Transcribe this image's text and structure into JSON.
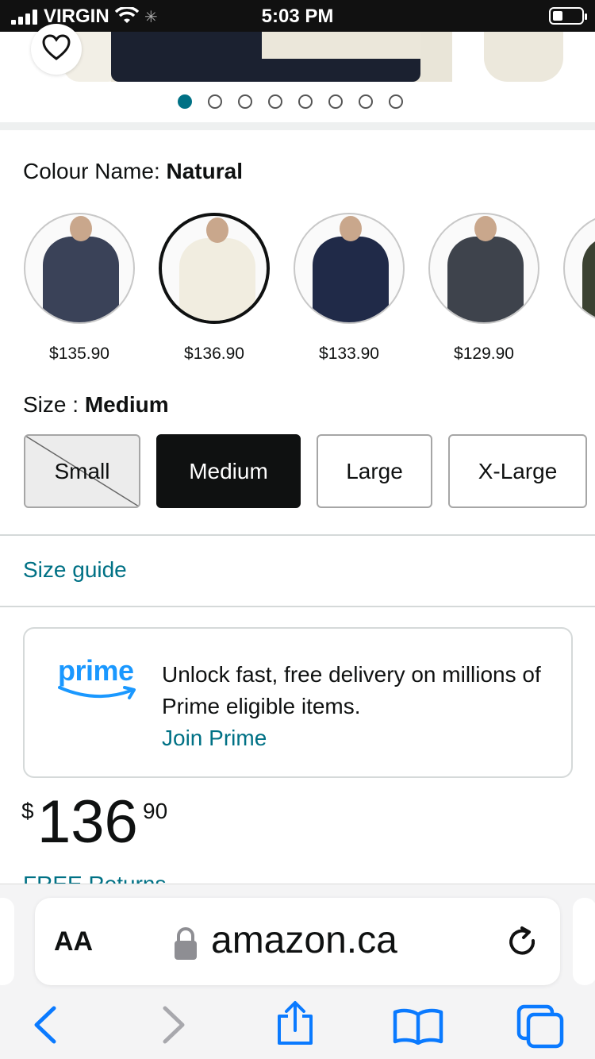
{
  "status_bar": {
    "carrier": "VIRGIN",
    "time": "5:03 PM"
  },
  "gallery": {
    "dot_count": 8,
    "active_index": 0
  },
  "colour": {
    "label": "Colour Name: ",
    "selected": "Natural",
    "options": [
      {
        "price": "$135.90",
        "color": "#3a4258"
      },
      {
        "price": "$136.90",
        "color": "#f1ede0"
      },
      {
        "price": "$133.90",
        "color": "#202a48"
      },
      {
        "price": "$129.90",
        "color": "#3e434c"
      },
      {
        "price": "$",
        "color": "#3b4232"
      }
    ]
  },
  "size": {
    "label": "Size : ",
    "selected": "Medium",
    "options": [
      {
        "label": "Small",
        "state": "unavailable"
      },
      {
        "label": "Medium",
        "state": "selected"
      },
      {
        "label": "Large",
        "state": "available"
      },
      {
        "label": "X-Large",
        "state": "available"
      }
    ]
  },
  "size_guide": "Size guide",
  "prime": {
    "logo_text": "prime",
    "message": "Unlock fast, free delivery on millions of Prime eligible items.",
    "link": "Join Prime"
  },
  "price": {
    "symbol": "$",
    "whole": "136",
    "fraction": "90"
  },
  "returns": "FREE Returns",
  "browser": {
    "text_size_label": "AA",
    "host": "amazon.ca"
  },
  "colors": {
    "link": "#007185",
    "ios_blue": "#0a7aff",
    "prime_blue": "#1a98ff"
  }
}
